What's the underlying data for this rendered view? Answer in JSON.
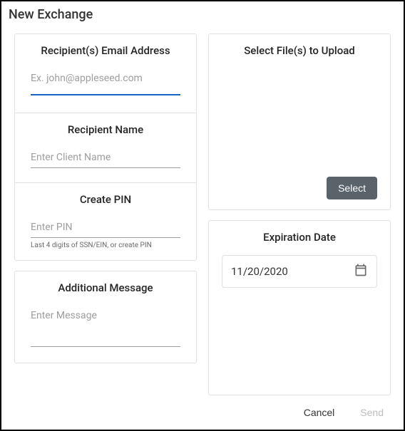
{
  "dialog": {
    "title": "New Exchange"
  },
  "left": {
    "email": {
      "title": "Recipient(s) Email Address",
      "placeholder": "Ex. john@appleseed.com",
      "value": ""
    },
    "name": {
      "title": "Recipient Name",
      "placeholder": "Enter Client Name",
      "value": ""
    },
    "pin": {
      "title": "Create PIN",
      "placeholder": "Enter PIN",
      "value": "",
      "helper": "Last 4 digits of SSN/EIN, or create PIN"
    },
    "message": {
      "title": "Additional Message",
      "placeholder": "Enter Message",
      "value": ""
    }
  },
  "right": {
    "upload": {
      "title": "Select File(s) to Upload",
      "select_label": "Select"
    },
    "expiration": {
      "title": "Expiration Date",
      "value": "11/20/2020"
    }
  },
  "footer": {
    "cancel": "Cancel",
    "send": "Send"
  }
}
